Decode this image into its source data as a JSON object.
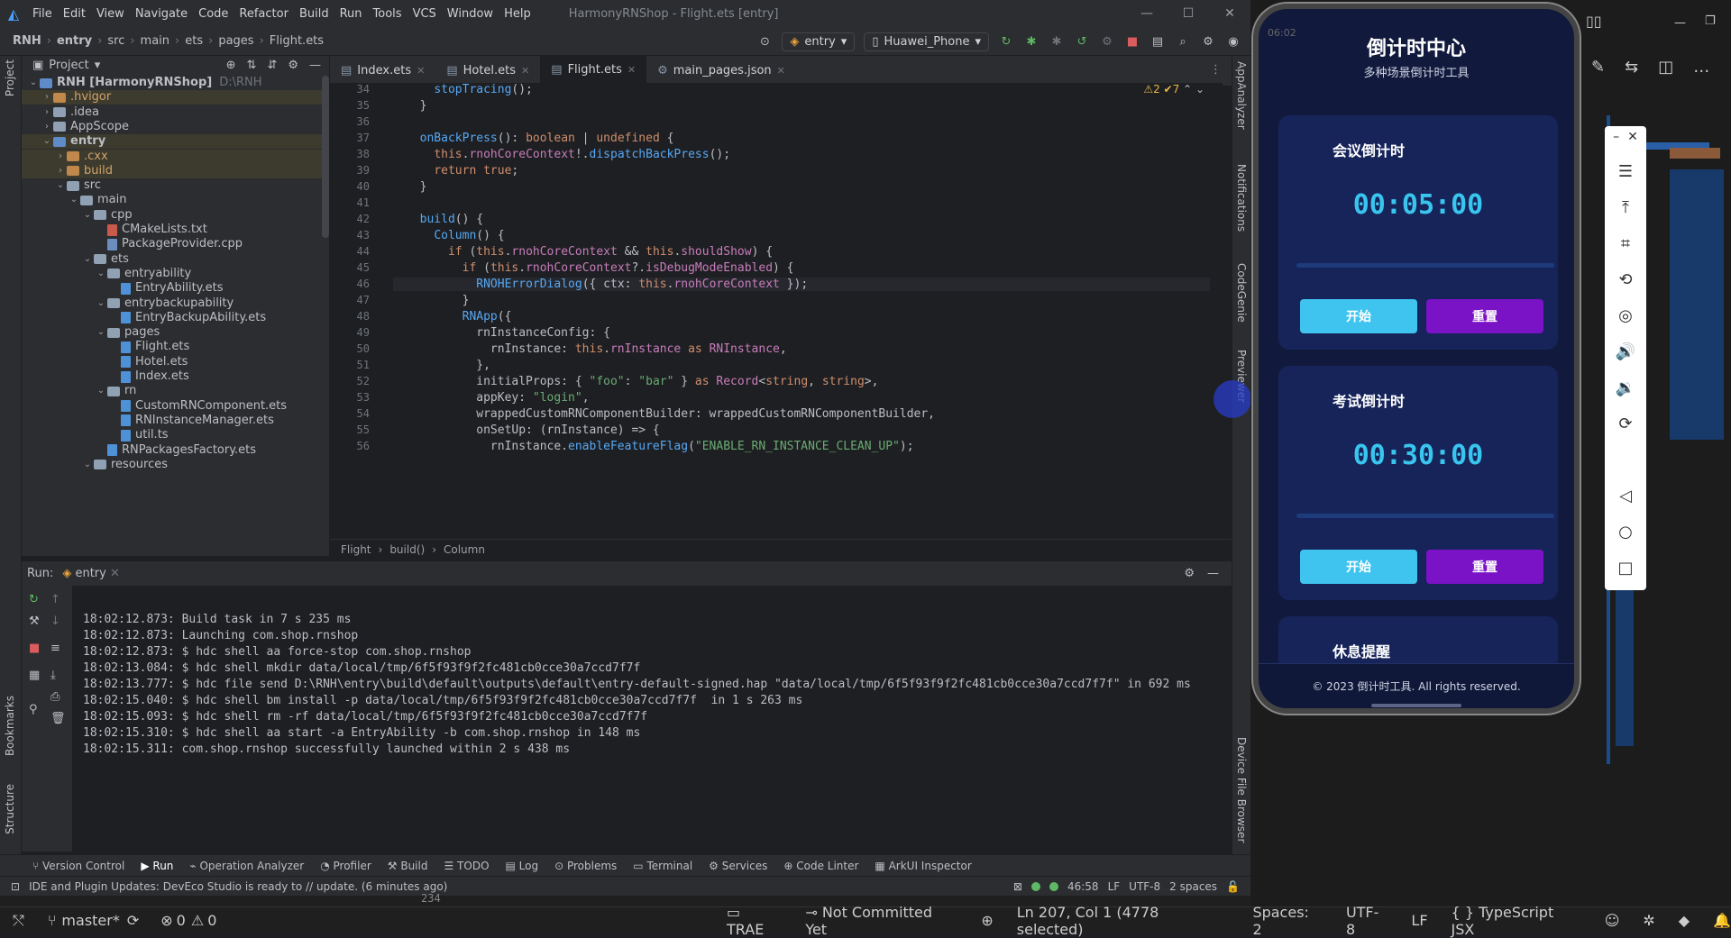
{
  "titlebar": {
    "menu": [
      "File",
      "Edit",
      "View",
      "Navigate",
      "Code",
      "Refactor",
      "Build",
      "Run",
      "Tools",
      "VCS",
      "Window",
      "Help"
    ],
    "title": "HarmonyRNShop - Flight.ets [entry]"
  },
  "navbar": {
    "crumbs": [
      "RNH",
      "entry",
      "src",
      "main",
      "ets",
      "pages",
      "Flight.ets"
    ],
    "run_config": "entry",
    "device": "Huawei_Phone"
  },
  "project": {
    "header": "Project",
    "tree": [
      {
        "label": "RNH [HarmonyRNShop]",
        "extra": "D:\\RNH",
        "depth": 0,
        "kind": "root",
        "open": true
      },
      {
        "label": ".hvigor",
        "depth": 1,
        "kind": "folder-orange",
        "open": false,
        "sel": true
      },
      {
        "label": ".idea",
        "depth": 1,
        "kind": "folder",
        "open": false
      },
      {
        "label": "AppScope",
        "depth": 1,
        "kind": "folder",
        "open": false
      },
      {
        "label": "entry",
        "depth": 1,
        "kind": "folder-blue",
        "open": true,
        "sel": true,
        "bold": true
      },
      {
        "label": ".cxx",
        "depth": 2,
        "kind": "folder-orange",
        "open": false,
        "sel": true
      },
      {
        "label": "build",
        "depth": 2,
        "kind": "folder-orange",
        "open": false,
        "sel": true
      },
      {
        "label": "src",
        "depth": 2,
        "kind": "folder",
        "open": true
      },
      {
        "label": "main",
        "depth": 3,
        "kind": "folder",
        "open": true
      },
      {
        "label": "cpp",
        "depth": 4,
        "kind": "folder",
        "open": true
      },
      {
        "label": "CMakeLists.txt",
        "depth": 5,
        "kind": "file-cm"
      },
      {
        "label": "PackageProvider.cpp",
        "depth": 5,
        "kind": "file-cpp"
      },
      {
        "label": "ets",
        "depth": 4,
        "kind": "folder",
        "open": true
      },
      {
        "label": "entryability",
        "depth": 5,
        "kind": "folder",
        "open": true
      },
      {
        "label": "EntryAbility.ets",
        "depth": 6,
        "kind": "file-ts"
      },
      {
        "label": "entrybackupability",
        "depth": 5,
        "kind": "folder",
        "open": true
      },
      {
        "label": "EntryBackupAbility.ets",
        "depth": 6,
        "kind": "file-ts"
      },
      {
        "label": "pages",
        "depth": 5,
        "kind": "folder",
        "open": true
      },
      {
        "label": "Flight.ets",
        "depth": 6,
        "kind": "file-ts"
      },
      {
        "label": "Hotel.ets",
        "depth": 6,
        "kind": "file-ts"
      },
      {
        "label": "Index.ets",
        "depth": 6,
        "kind": "file-ts"
      },
      {
        "label": "rn",
        "depth": 5,
        "kind": "folder",
        "open": true
      },
      {
        "label": "CustomRNComponent.ets",
        "depth": 6,
        "kind": "file-ts"
      },
      {
        "label": "RNInstanceManager.ets",
        "depth": 6,
        "kind": "file-ts"
      },
      {
        "label": "util.ts",
        "depth": 6,
        "kind": "file-ts"
      },
      {
        "label": "RNPackagesFactory.ets",
        "depth": 5,
        "kind": "file-ts"
      },
      {
        "label": "resources",
        "depth": 4,
        "kind": "folder",
        "open": true
      }
    ]
  },
  "tabs": [
    {
      "label": "Index.ets",
      "active": false
    },
    {
      "label": "Hotel.ets",
      "active": false
    },
    {
      "label": "Flight.ets",
      "active": true
    },
    {
      "label": "main_pages.json",
      "active": false
    }
  ],
  "editor": {
    "inspection": "⚠2 ✔7",
    "lines": [
      {
        "n": "34",
        "html": "    <span class='fn'>stopTracing</span>();"
      },
      {
        "n": "35",
        "html": "  }"
      },
      {
        "n": "36",
        "html": ""
      },
      {
        "n": "37",
        "html": "  <span class='fn'>onBackPress</span>(): <span class='kw'>boolean</span> | <span class='kw'>undefined</span> {"
      },
      {
        "n": "38",
        "html": "    <span class='kw'>this</span>.<span class='pr'>rnohCoreContext</span>!.<span class='fn'>dispatchBackPress</span>();"
      },
      {
        "n": "39",
        "html": "    <span class='kw'>return true</span>;"
      },
      {
        "n": "40",
        "html": "  }"
      },
      {
        "n": "41",
        "html": ""
      },
      {
        "n": "42",
        "html": "  <span class='fn'>build</span>() {"
      },
      {
        "n": "43",
        "html": "    <span class='fn'>Column</span>() {"
      },
      {
        "n": "44",
        "html": "      <span class='kw'>if</span> (<span class='kw'>this</span>.<span class='pr'>rnohCoreContext</span> &amp;&amp; <span class='kw'>this</span>.<span class='pr'>shouldShow</span>) {"
      },
      {
        "n": "45",
        "html": "        <span class='kw'>if</span> (<span class='kw'>this</span>.<span class='pr'>rnohCoreContext</span>?.<span class='pr'>isDebugModeEnabled</span>) {"
      },
      {
        "n": "46",
        "html": "          <span class='fn'>RNOHErrorDialog</span>({ ctx: <span class='kw'>this</span>.<span class='pr'>rnohCoreContext</span> });",
        "cur": true
      },
      {
        "n": "47",
        "html": "        }"
      },
      {
        "n": "48",
        "html": "        <span class='fn'>RNApp</span>({"
      },
      {
        "n": "49",
        "html": "          rnInstanceConfig: {"
      },
      {
        "n": "50",
        "html": "            rnInstance: <span class='kw'>this</span>.<span class='pr'>rnInstance</span> <span class='kw'>as</span> <span class='ty'>RNInstance</span>,"
      },
      {
        "n": "51",
        "html": "          },"
      },
      {
        "n": "52",
        "html": "          initialProps: { <span class='st'>\"foo\"</span>: <span class='st'>\"bar\"</span> } <span class='kw'>as</span> <span class='ty'>Record</span>&lt;<span class='kw'>string</span>, <span class='kw'>string</span>&gt;,"
      },
      {
        "n": "53",
        "html": "          appKey: <span class='st'>\"login\"</span>,"
      },
      {
        "n": "54",
        "html": "          wrappedCustomRNComponentBuilder: wrappedCustomRNComponentBuilder,"
      },
      {
        "n": "55",
        "html": "          onSetUp: (rnInstance) =&gt; {"
      },
      {
        "n": "56",
        "html": "            rnInstance.<span class='fn'>enableFeatureFlag</span>(<span class='st'>\"ENABLE_RN_INSTANCE_CLEAN_UP\"</span>);"
      }
    ],
    "breadcrumb": [
      "Flight",
      "build()",
      "Column"
    ]
  },
  "run": {
    "label": "Run:",
    "config": "entry",
    "logs": [
      "18:02:12.873: Build task in 7 s 235 ms",
      "18:02:12.873: Launching com.shop.rnshop",
      "18:02:12.873: $ hdc shell aa force-stop com.shop.rnshop",
      "18:02:13.084: $ hdc shell mkdir data/local/tmp/6f5f93f9f2fc481cb0cce30a7ccd7f7f",
      "18:02:13.777: $ hdc file send D:\\RNH\\entry\\build\\default\\outputs\\default\\entry-default-signed.hap \"data/local/tmp/6f5f93f9f2fc481cb0cce30a7ccd7f7f\" in 692 ms",
      "18:02:15.040: $ hdc shell bm install -p data/local/tmp/6f5f93f9f2fc481cb0cce30a7ccd7f7f  in 1 s 263 ms",
      "18:02:15.093: $ hdc shell rm -rf data/local/tmp/6f5f93f9f2fc481cb0cce30a7ccd7f7f",
      "18:02:15.310: $ hdc shell aa start -a EntryAbility -b com.shop.rnshop in 148 ms",
      "18:02:15.311: com.shop.rnshop successfully launched within 2 s 438 ms"
    ]
  },
  "bottomtabs": [
    "Version Control",
    "Run",
    "Operation Analyzer",
    "Profiler",
    "Build",
    "TODO",
    "Log",
    "Problems",
    "Terminal",
    "Services",
    "Code Linter",
    "ArkUI Inspector"
  ],
  "status": {
    "message": "IDE and Plugin Updates: DevEco Studio is ready to // update. (6 minutes ago)",
    "pos": "46:58",
    "lf": "LF",
    "enc": "UTF-8",
    "indent": "2 spaces"
  },
  "leftstrip": {
    "project": "Project",
    "bookmarks": "Bookmarks",
    "structure": "Structure"
  },
  "rightstrip": {
    "a": "AppAnalyzer",
    "b": "Notifications",
    "c": "CodeGenie",
    "d": "Previewer",
    "e": "Device File Browser"
  },
  "vscode": {
    "branch": "master*",
    "errors": "0",
    "warnings": "0",
    "trae": "TRAE",
    "commit": "Not Committed Yet",
    "cursor": "Ln 207, Col 1 (4778 selected)",
    "spaces": "Spaces: 2",
    "enc": "UTF-8",
    "lf": "LF",
    "lang": "TypeScript JSX",
    "bg_line": "234"
  },
  "phone": {
    "clock": "06:02",
    "app_title": "倒计时中心",
    "app_subtitle": "多种场景倒计时工具",
    "cards": [
      {
        "title": "会议倒计时",
        "time": "00:05:00",
        "start": "开始",
        "reset": "重置"
      },
      {
        "title": "考试倒计时",
        "time": "00:30:00",
        "start": "开始",
        "reset": "重置"
      },
      {
        "title": "休息提醒"
      }
    ],
    "footer": "© 2023 倒计时工具. All rights reserved."
  }
}
